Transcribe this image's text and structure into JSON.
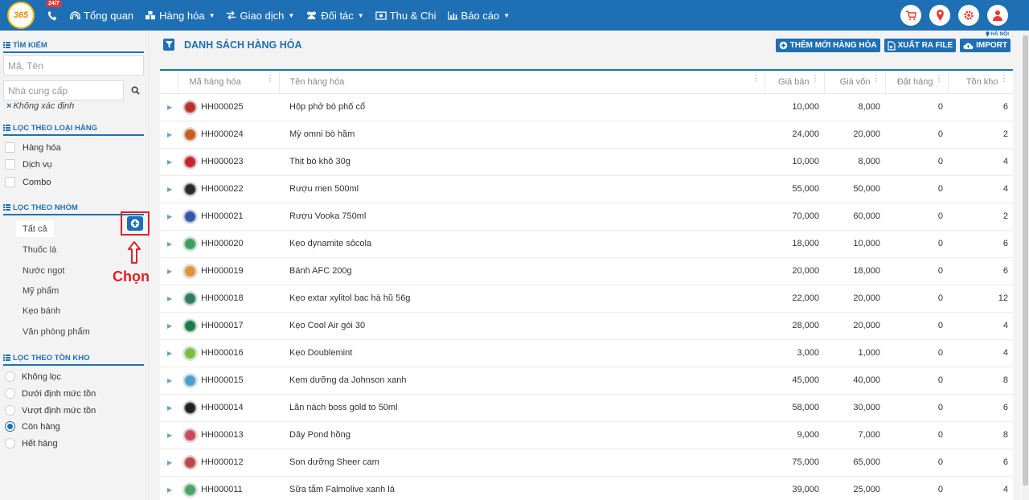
{
  "topbar": {
    "logo": "365",
    "hotline_badge": "24/7",
    "nav": [
      {
        "label": "Tổng quan",
        "icon": "dashboard-icon",
        "caret": false
      },
      {
        "label": "Hàng hóa",
        "icon": "boxes-icon",
        "caret": true
      },
      {
        "label": "Giao dịch",
        "icon": "exchange-icon",
        "caret": true
      },
      {
        "label": "Đối tác",
        "icon": "users-icon",
        "caret": true
      },
      {
        "label": "Thu & Chi",
        "icon": "money-icon",
        "caret": false
      },
      {
        "label": "Báo cáo",
        "icon": "bar-chart-icon",
        "caret": true
      }
    ],
    "icons": [
      "cart-icon",
      "location-icon",
      "gear-icon",
      "user-icon"
    ],
    "accent": "#1f6fb5",
    "danger": "#e53935"
  },
  "sidebar": {
    "search": {
      "title": "TÌM KIẾM",
      "code_placeholder": "Mã, Tên",
      "supplier_placeholder": "Nhà cung cấp",
      "unknown": "Không xác định"
    },
    "type_filter": {
      "title": "LỌC THEO LOẠI HÀNG",
      "items": [
        "Hàng hóa",
        "Dịch vụ",
        "Combo"
      ]
    },
    "group_filter": {
      "title": "LỌC THEO NHÓM",
      "items": [
        "Tất cả",
        "Thuốc lá",
        "Nước ngọt",
        "Mỹ phẩm",
        "Kẹo bánh",
        "Văn phòng phẩm"
      ],
      "annotation": "Chọn"
    },
    "stock_filter": {
      "title": "LỌC THEO TỒN KHO",
      "items": [
        "Không lọc",
        "Dưới định mức tồn",
        "Vượt định mức tồn",
        "Còn hàng",
        "Hết hàng"
      ],
      "selected": "Còn hàng"
    }
  },
  "main": {
    "title": "DANH SÁCH HÀNG HÓA",
    "region": "HÀ NỘI",
    "actions": [
      {
        "label": "THÊM MỚI HÀNG HÓA",
        "icon": "plus-circle-icon"
      },
      {
        "label": "XUẤT RA FILE",
        "icon": "file-export-icon"
      },
      {
        "label": "IMPORT",
        "icon": "cloud-upload-icon"
      }
    ],
    "columns": [
      "Mã hàng hóa",
      "Tên hàng hóa",
      "Giá bán",
      "Giá vốn",
      "Đặt hàng",
      "Tồn kho"
    ],
    "rows": [
      {
        "code": "HH000025",
        "name": "Hộp phở bò phố cổ",
        "price": "10,000",
        "cost": "8,000",
        "ordered": "0",
        "stock": "6",
        "thumb_color": "#b8322b"
      },
      {
        "code": "HH000024",
        "name": "Mỳ omni bò hầm",
        "price": "24,000",
        "cost": "20,000",
        "ordered": "0",
        "stock": "2",
        "thumb_color": "#c4601f"
      },
      {
        "code": "HH000023",
        "name": "Thịt bò khô 30g",
        "price": "10,000",
        "cost": "8,000",
        "ordered": "0",
        "stock": "4",
        "thumb_color": "#c0262c"
      },
      {
        "code": "HH000022",
        "name": "Rượu men 500ml",
        "price": "55,000",
        "cost": "50,000",
        "ordered": "0",
        "stock": "4",
        "thumb_color": "#2a2a2a"
      },
      {
        "code": "HH000021",
        "name": "Rượu Vooka 750ml",
        "price": "70,000",
        "cost": "60,000",
        "ordered": "0",
        "stock": "2",
        "thumb_color": "#3257a8"
      },
      {
        "code": "HH000020",
        "name": "Kẹo dynamite sôcola",
        "price": "18,000",
        "cost": "10,000",
        "ordered": "0",
        "stock": "6",
        "thumb_color": "#3aa05b"
      },
      {
        "code": "HH000019",
        "name": "Bánh AFC 200g",
        "price": "20,000",
        "cost": "18,000",
        "ordered": "0",
        "stock": "6",
        "thumb_color": "#d8963a"
      },
      {
        "code": "HH000018",
        "name": "Kẹo extar xylitol bac hà hũ 56g",
        "price": "22,000",
        "cost": "20,000",
        "ordered": "0",
        "stock": "12",
        "thumb_color": "#2f7b62"
      },
      {
        "code": "HH000017",
        "name": "Kẹo Cool Air gói 30",
        "price": "28,000",
        "cost": "20,000",
        "ordered": "0",
        "stock": "4",
        "thumb_color": "#1c7a43"
      },
      {
        "code": "HH000016",
        "name": "Kẹo Doublemint",
        "price": "3,000",
        "cost": "1,000",
        "ordered": "0",
        "stock": "4",
        "thumb_color": "#77c043"
      },
      {
        "code": "HH000015",
        "name": "Kem dưỡng da Johnson xanh",
        "price": "45,000",
        "cost": "40,000",
        "ordered": "0",
        "stock": "8",
        "thumb_color": "#4a9fd0"
      },
      {
        "code": "HH000014",
        "name": "Lăn nách boss gold to 50ml",
        "price": "58,000",
        "cost": "30,000",
        "ordered": "0",
        "stock": "6",
        "thumb_color": "#1e1e1e"
      },
      {
        "code": "HH000013",
        "name": "Dây Pond hồng",
        "price": "9,000",
        "cost": "7,000",
        "ordered": "0",
        "stock": "8",
        "thumb_color": "#c94a5e"
      },
      {
        "code": "HH000012",
        "name": "Son dưỡng Sheer cam",
        "price": "75,000",
        "cost": "65,000",
        "ordered": "0",
        "stock": "6",
        "thumb_color": "#b94848"
      },
      {
        "code": "HH000011",
        "name": "Sữa tắm Falmolive xanh lá",
        "price": "39,000",
        "cost": "25,000",
        "ordered": "0",
        "stock": "4",
        "thumb_color": "#4aa36b"
      }
    ]
  }
}
